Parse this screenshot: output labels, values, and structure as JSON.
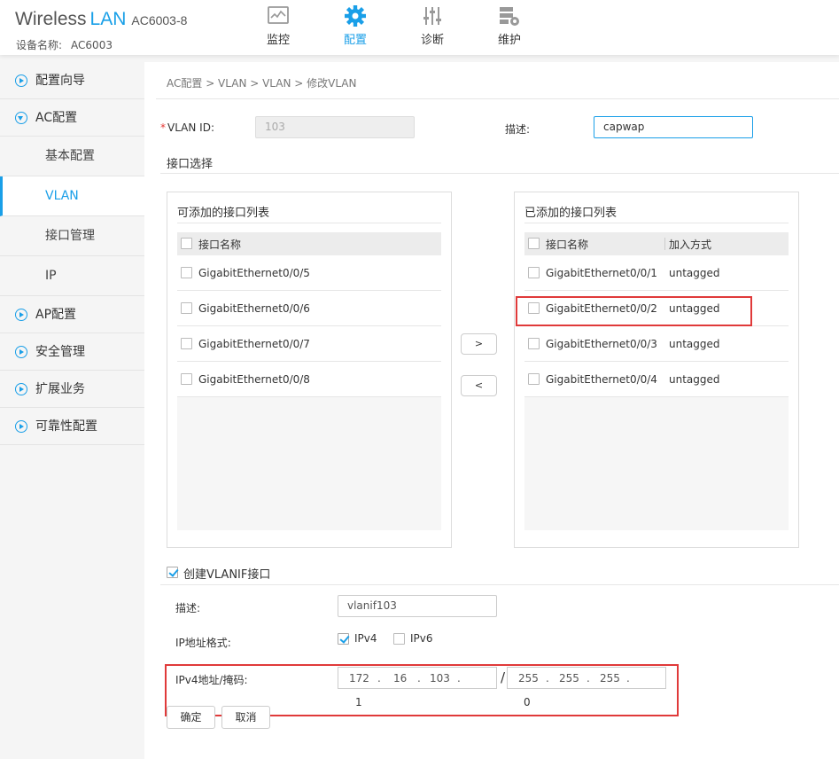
{
  "header": {
    "brand_name": "Wireless",
    "brand_lan": "LAN",
    "model": "AC6003-8",
    "device_label": "设备名称:",
    "device_name": "AC6003",
    "nav": [
      {
        "label": "监控",
        "icon": "monitor-icon"
      },
      {
        "label": "配置",
        "icon": "gear-icon",
        "active": true
      },
      {
        "label": "诊断",
        "icon": "sliders-icon"
      },
      {
        "label": "维护",
        "icon": "maintenance-icon"
      }
    ]
  },
  "sidebar": {
    "items": [
      {
        "label": "配置向导"
      },
      {
        "label": "AC配置",
        "expanded": true,
        "children": [
          "基本配置",
          "VLAN",
          "接口管理",
          "IP"
        ],
        "active_child": "VLAN"
      },
      {
        "label": "AP配置"
      },
      {
        "label": "安全管理"
      },
      {
        "label": "扩展业务"
      },
      {
        "label": "可靠性配置"
      }
    ]
  },
  "main": {
    "breadcrumb": "AC配置 > VLAN > VLAN > 修改VLAN",
    "vlan_id_label": "VLAN ID:",
    "vlan_id_value": "103",
    "desc_label": "描述:",
    "desc_value": "capwap",
    "interface_section": "接口选择",
    "available": {
      "title": "可添加的接口列表",
      "col_name": "接口名称",
      "rows": [
        "GigabitEthernet0/0/5",
        "GigabitEthernet0/0/6",
        "GigabitEthernet0/0/7",
        "GigabitEthernet0/0/8"
      ]
    },
    "added": {
      "title": "已添加的接口列表",
      "col_name": "接口名称",
      "col_mode": "加入方式",
      "rows": [
        {
          "name": "GigabitEthernet0/0/1",
          "mode": "untagged"
        },
        {
          "name": "GigabitEthernet0/0/2",
          "mode": "untagged"
        },
        {
          "name": "GigabitEthernet0/0/3",
          "mode": "untagged"
        },
        {
          "name": "GigabitEthernet0/0/4",
          "mode": "untagged"
        }
      ]
    },
    "move_right": ">",
    "move_left": "<",
    "vlanif": {
      "create_label": "创建VLANIF接口",
      "checked": true,
      "desc_label": "描述:",
      "desc_value": "vlanif103",
      "ip_format_label": "IP地址格式:",
      "ipv4_label": "IPv4",
      "ipv4_checked": true,
      "ipv6_label": "IPv6",
      "ipv6_checked": false,
      "ipmask_label": "IPv4地址/掩码:",
      "ip_octets": [
        "172",
        "16",
        "103",
        "1"
      ],
      "mask_octets": [
        "255",
        "255",
        "255",
        "0"
      ],
      "slash": "/",
      "dot": "."
    },
    "ok_label": "确定",
    "cancel_label": "取消"
  },
  "colors": {
    "accent": "#1a9fe8",
    "highlight_box": "#e03a3a"
  }
}
